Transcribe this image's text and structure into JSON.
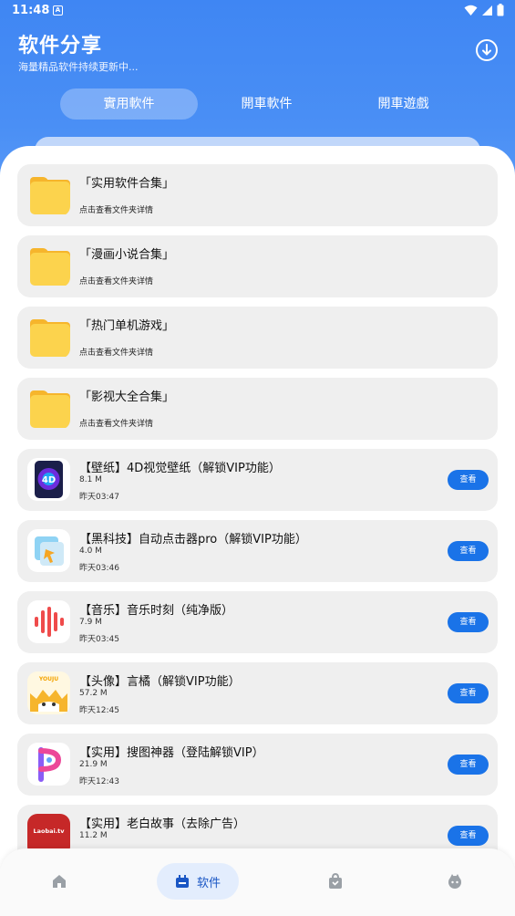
{
  "status_bar": {
    "time": "11:48",
    "notif_icon": "A"
  },
  "header": {
    "title": "软件分享",
    "subtitle": "海量精品软件持续更新中..."
  },
  "tabs": [
    {
      "label": "實用軟件",
      "active": true
    },
    {
      "label": "開車軟件",
      "active": false
    },
    {
      "label": "開車遊戲",
      "active": false
    }
  ],
  "folders": [
    {
      "title": "「实用软件合集」",
      "hint": "点击查看文件夹详情"
    },
    {
      "title": "「漫画小说合集」",
      "hint": "点击查看文件夹详情"
    },
    {
      "title": "「热门单机游戏」",
      "hint": "点击查看文件夹详情"
    },
    {
      "title": "「影视大全合集」",
      "hint": "点击查看文件夹详情"
    }
  ],
  "apps": [
    {
      "title": "【壁纸】4D视觉壁纸（解锁VIP功能）",
      "size": "8.1 M",
      "time": "昨天03:47",
      "button": "查看",
      "icon": "wallpaper-4d-icon"
    },
    {
      "title": "【黑科技】自动点击器pro（解锁VIP功能）",
      "size": "4.0 M",
      "time": "昨天03:46",
      "button": "查看",
      "icon": "auto-clicker-icon"
    },
    {
      "title": "【音乐】音乐时刻（纯净版）",
      "size": "7.9 M",
      "time": "昨天03:45",
      "button": "查看",
      "icon": "music-wave-icon"
    },
    {
      "title": "【头像】言橘（解锁VIP功能）",
      "size": "57.2 M",
      "time": "昨天12:45",
      "button": "查看",
      "icon": "avatar-cat-icon"
    },
    {
      "title": "【实用】搜图神器（登陆解锁VIP）",
      "size": "21.9 M",
      "time": "昨天12:43",
      "button": "查看",
      "icon": "image-search-icon"
    },
    {
      "title": "【实用】老白故事（去除广告）",
      "size": "11.2 M",
      "time": "",
      "button": "查看",
      "icon": "laobai-tv-icon",
      "icon_text": "Laobai.tv"
    }
  ],
  "bottom_nav": [
    {
      "icon": "home-icon",
      "label": "",
      "active": false
    },
    {
      "icon": "software-icon",
      "label": "软件",
      "active": true
    },
    {
      "icon": "shop-bag-icon",
      "label": "",
      "active": false
    },
    {
      "icon": "profile-icon",
      "label": "",
      "active": false
    }
  ],
  "colors": {
    "primary": "#4a8ff5",
    "button": "#1a73e8",
    "card": "#efefef",
    "folder": "#fcd34d"
  }
}
